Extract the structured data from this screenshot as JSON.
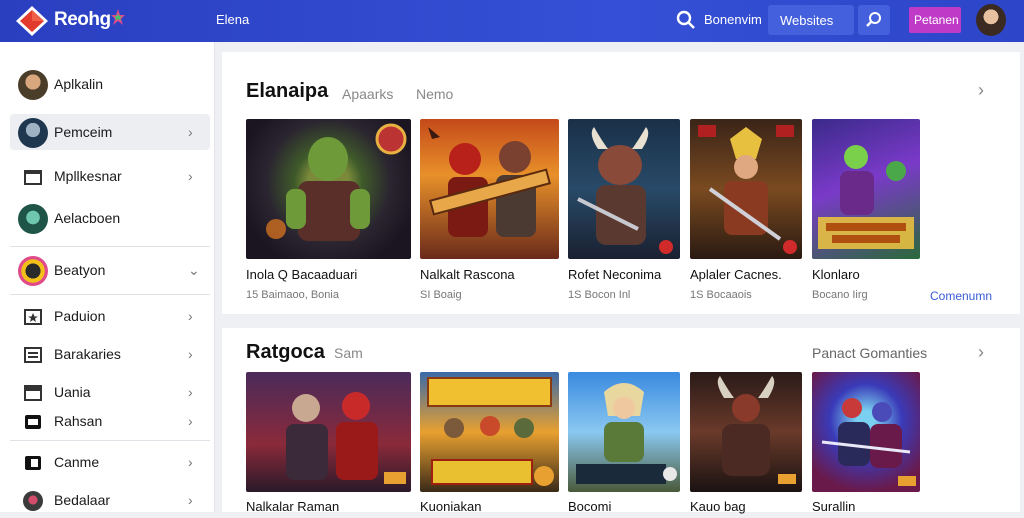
{
  "header": {
    "brand": "Reohg",
    "nav_link": "Elena",
    "search_label": "Bonenvim",
    "websites_label": "Websites",
    "cta_label": "Petanen",
    "accent": "#2f48cc"
  },
  "sidebar": {
    "items": [
      {
        "label": "Aplkalin",
        "icon": "avatar-icon",
        "chevron": ""
      },
      {
        "label": "Pemceim",
        "icon": "avatar-icon",
        "chevron": "›"
      },
      {
        "label": "Mpllkesnar",
        "icon": "window-icon",
        "chevron": "›"
      },
      {
        "label": "Aelacboen",
        "icon": "avatar-icon",
        "chevron": ""
      },
      {
        "label": "Beatyon",
        "icon": "game-icon",
        "chevron": "⌄"
      },
      {
        "label": "Paduion",
        "icon": "star-box-icon",
        "chevron": "›"
      },
      {
        "label": "Barakaries",
        "icon": "list-icon",
        "chevron": "›"
      },
      {
        "label": "Uania",
        "icon": "inbox-icon",
        "chevron": "›"
      },
      {
        "label": "Rahsan",
        "icon": "film-icon",
        "chevron": "›"
      },
      {
        "label": "Canme",
        "icon": "square-icon",
        "chevron": "›"
      },
      {
        "label": "Bedalaar",
        "icon": "avatar-icon",
        "chevron": "›"
      }
    ]
  },
  "section1": {
    "title": "Elanaipa",
    "tabs": [
      "Apaarks",
      "Nemo"
    ],
    "link": "Comenumn",
    "cards": [
      {
        "title": "Inola Q Bacaaduari",
        "sub": "15 Baimaoo, Bonia"
      },
      {
        "title": "Nalkalt Rascona",
        "sub": "SI Boaig"
      },
      {
        "title": "Rofet Neconima",
        "sub": "1S Bocon Inl"
      },
      {
        "title": "Aplaler Cacnes.",
        "sub": "1S Bocaaois"
      },
      {
        "title": "Klonlaro",
        "sub": "Bocano Iirg"
      }
    ]
  },
  "section2": {
    "title": "Ratgoca",
    "tab": "Sam",
    "right_label": "Panact Gomanties",
    "cards": [
      {
        "title": "Nalkalar Raman"
      },
      {
        "title": "Kuoniakan"
      },
      {
        "title": "Bocomi"
      },
      {
        "title": "Kauo bag"
      },
      {
        "title": "Surallin"
      }
    ]
  }
}
